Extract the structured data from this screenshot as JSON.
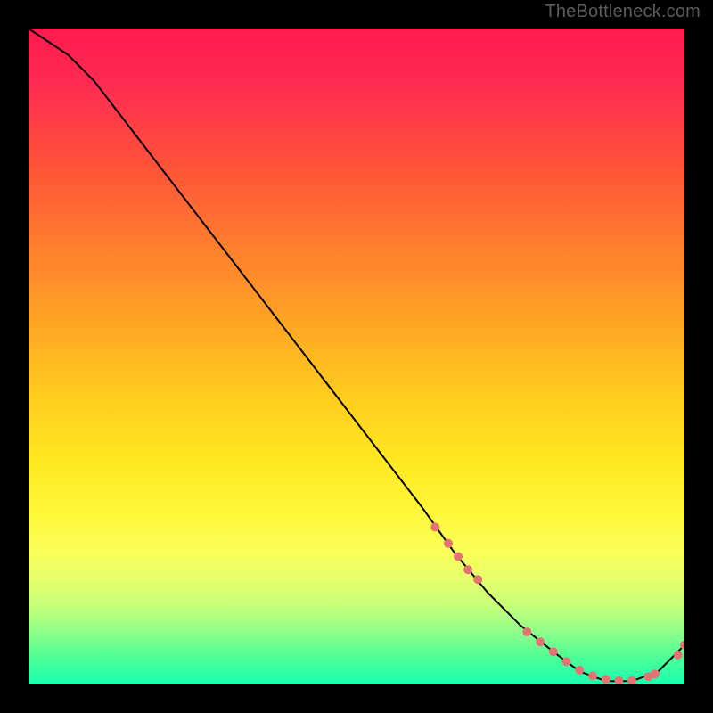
{
  "attribution": "TheBottleneck.com",
  "chart_data": {
    "type": "line",
    "title": "",
    "xlabel": "",
    "ylabel": "",
    "xlim": [
      0,
      100
    ],
    "ylim": [
      0,
      100
    ],
    "curve": {
      "name": "bottleneck-curve",
      "x": [
        0,
        6,
        10,
        20,
        30,
        40,
        50,
        60,
        65,
        70,
        75,
        80,
        84,
        88,
        92,
        96,
        100
      ],
      "y": [
        100,
        96,
        92,
        79,
        66,
        53,
        40,
        27,
        20,
        14,
        9,
        5,
        2,
        0.5,
        0.5,
        2,
        6
      ]
    },
    "data_points": {
      "name": "highlight-dots",
      "x": [
        62,
        64,
        65.5,
        67,
        68.5,
        76,
        78,
        80,
        82,
        84,
        86,
        88,
        90,
        92,
        94.5,
        95.5,
        99,
        100
      ],
      "y": [
        24,
        21.5,
        19.5,
        17.5,
        16,
        8,
        6.5,
        5,
        3.5,
        2.2,
        1.3,
        0.8,
        0.6,
        0.6,
        1.2,
        1.6,
        4.5,
        6
      ]
    },
    "colors": {
      "gradient_top": "#ff1a4d",
      "gradient_mid": "#ffe820",
      "gradient_bottom": "#1affb0",
      "curve": "#000000",
      "dots": "#e57373",
      "background": "#000000"
    }
  }
}
